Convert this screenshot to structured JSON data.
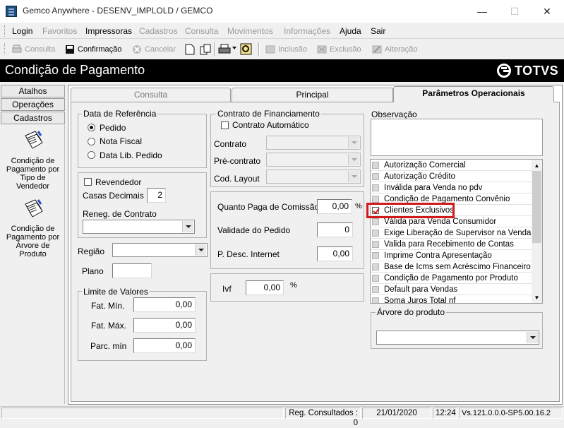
{
  "window": {
    "title": "Gemco Anywhere - DESENV_IMPLOLD / GEMCO",
    "minimize": "—",
    "maximize": "☐",
    "close": "✕"
  },
  "menu": [
    "Login",
    "Favoritos",
    "Impressoras",
    "Cadastros",
    "Consulta",
    "Movimentos",
    "Informações",
    "Ajuda",
    "Sair"
  ],
  "toolbar": {
    "consulta": "Consulta",
    "confirmacao": "Confirmação",
    "cancelar": "Cancelar",
    "inclusao": "Inclusão",
    "exclusao": "Exclusão",
    "alteracao": "Alteração"
  },
  "header": {
    "title": "Condição de Pagamento",
    "brand": "TOTVS"
  },
  "left_panel": {
    "tabs": [
      "Atalhos",
      "Operações",
      "Cadastros"
    ],
    "items": [
      "Condição de Pagamento por Tipo de Vendedor",
      "Condição de Pagamento por Árvore de Produto"
    ]
  },
  "tabs": [
    "Consulta",
    "Principal",
    "Parâmetros Operacionais"
  ],
  "data_referencia": {
    "title": "Data de Referência",
    "options": [
      "Pedido",
      "Nota Fiscal",
      "Data Lib. Pedido"
    ],
    "selected": "Pedido"
  },
  "revendedor": {
    "label": "Revendedor",
    "checked": false
  },
  "casas_decimais": {
    "label": "Casas Decimais",
    "value": "2"
  },
  "reneg_contrato": {
    "label": "Reneg. de Contrato",
    "value": ""
  },
  "regiao": {
    "label": "Região",
    "value": ""
  },
  "plano": {
    "label": "Plano",
    "value": ""
  },
  "limite_valores": {
    "title": "Limite de Valores",
    "fat_min": {
      "label": "Fat. Mín.",
      "value": "0,00"
    },
    "fat_max": {
      "label": "Fat. Máx.",
      "value": "0,00"
    },
    "parc_min": {
      "label": "Parc. mín",
      "value": "0,00"
    }
  },
  "contrato_financiamento": {
    "title": "Contrato de Financiamento",
    "automatico": "Contrato Automático",
    "contrato": "Contrato",
    "pre_contrato": "Pré-contrato",
    "cod_layout": "Cod. Layout"
  },
  "comissao": {
    "quanto_paga": {
      "label": "Quanto Paga de Comissão",
      "value": "0,00",
      "unit": "%"
    },
    "validade": {
      "label": "Validade do Pedido",
      "value": "0"
    },
    "desc_internet": {
      "label": "P. Desc. Internet",
      "value": "0,00"
    }
  },
  "ivf": {
    "label": "Ivf",
    "value": "0,00",
    "unit": "%"
  },
  "observacao": {
    "title": "Observação",
    "value": ""
  },
  "options_list": {
    "items": [
      {
        "label": "Autorização Comercial",
        "checked": false
      },
      {
        "label": "Autorização Crédito",
        "checked": false
      },
      {
        "label": "Inválida para Venda no pdv",
        "checked": false
      },
      {
        "label": "Condição de Pagamento Convênio",
        "checked": false
      },
      {
        "label": "Clientes Exclusivos",
        "checked": true
      },
      {
        "label": "Válida para Venda Consumidor",
        "checked": false
      },
      {
        "label": "Exige Liberação de Supervisor na Venda",
        "checked": false
      },
      {
        "label": "Valida para Recebimento de Contas",
        "checked": false
      },
      {
        "label": "Imprime Contra Apresentação",
        "checked": false
      },
      {
        "label": "Base de Icms sem Acréscimo Financeiro",
        "checked": false
      },
      {
        "label": "Condição de Pagamento por Produto",
        "checked": false
      },
      {
        "label": "Default para Vendas",
        "checked": false
      },
      {
        "label": "Soma Juros Total nf",
        "checked": false
      }
    ],
    "highlight_color": "#d11a1a"
  },
  "arvore_produto": {
    "title": "Árvore do produto",
    "value": ""
  },
  "status": {
    "reg": "Reg. Consultados : 0",
    "date": "21/01/2020",
    "time": "12:24",
    "version": "Vs.121.0.0.0-SP5.00.16.2"
  }
}
